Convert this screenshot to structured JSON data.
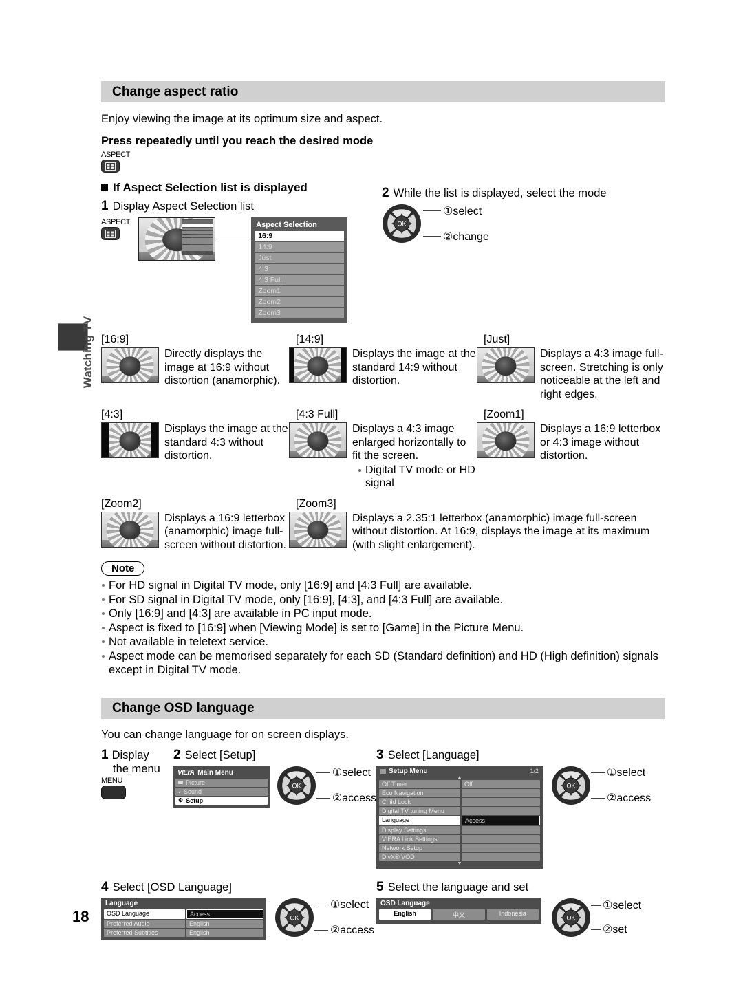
{
  "sidebar": {
    "tab_label": "Watching TV"
  },
  "page_number": "18",
  "section1": {
    "heading": "Change aspect ratio",
    "intro": "Enjoy viewing the image at its optimum size and aspect.",
    "instruction": "Press repeatedly until you reach the desired mode",
    "aspect_key_label": "ASPECT",
    "subheading": "If Aspect Selection list is displayed",
    "step1": {
      "num": "1",
      "text": "Display Aspect Selection list",
      "key_label": "ASPECT"
    },
    "step2": {
      "num": "2",
      "text": "While the list is displayed, select the mode",
      "annot1": "select",
      "annot2": "change",
      "marker1": "①",
      "marker2": "②"
    },
    "aspect_selection": {
      "title": "Aspect Selection",
      "items": [
        "16:9",
        "14:9",
        "Just",
        "4:3",
        "4:3 Full",
        "Zoom1",
        "Zoom2",
        "Zoom3"
      ],
      "selected_index": 0
    },
    "modes": [
      {
        "name": "[16:9]",
        "desc": "Directly displays the image at 16:9 without distortion (anamorphic).",
        "bars": "none"
      },
      {
        "name": "[14:9]",
        "desc": "Displays the image at the standard 14:9 without distortion.",
        "bars": "thin"
      },
      {
        "name": "[Just]",
        "desc": "Displays a 4:3 image full-screen. Stretching is only noticeable at the left and right edges.",
        "bars": "none"
      },
      {
        "name": "[4:3]",
        "desc": "Displays the image at the standard 4:3 without distortion.",
        "bars": "wide"
      },
      {
        "name": "[4:3 Full]",
        "desc": "Displays a 4:3 image enlarged horizontally to fit the screen.",
        "sub": "Digital TV mode or HD signal",
        "bars": "none"
      },
      {
        "name": "[Zoom1]",
        "desc": "Displays a 16:9 letterbox or 4:3 image without distortion.",
        "bars": "none"
      },
      {
        "name": "[Zoom2]",
        "desc": "Displays a 16:9 letterbox (anamorphic) image full-screen without distortion.",
        "bars": "none"
      },
      {
        "name": "[Zoom3]",
        "desc": "Displays a 2.35:1 letterbox (anamorphic) image full-screen without distortion. At 16:9, displays the image at its maximum (with slight enlargement).",
        "bars": "none"
      }
    ],
    "note": {
      "label": "Note",
      "items": [
        "For HD signal in Digital TV mode, only [16:9] and [4:3 Full] are available.",
        "For SD signal in Digital TV mode, only [16:9], [4:3], and [4:3 Full] are available.",
        "Only [16:9] and [4:3] are available in PC input mode.",
        "Aspect is fixed to [16:9] when [Viewing Mode] is set to [Game] in the Picture Menu.",
        "Not available in teletext service.",
        "Aspect mode can be memorised separately for each SD (Standard definition) and HD (High definition) signals except in Digital TV mode."
      ]
    }
  },
  "section2": {
    "heading": "Change OSD language",
    "intro": "You can change language for on screen displays.",
    "step1": {
      "num": "1",
      "line1": "Display",
      "line2": "the menu",
      "key_label": "MENU"
    },
    "step2": {
      "num": "2",
      "text": "Select [Setup]",
      "annot1": "select",
      "annot2": "access",
      "marker1": "①",
      "marker2": "②",
      "menu": {
        "brand": "VIErA",
        "title": "Main Menu",
        "items": [
          {
            "label": "Picture",
            "icon": "picture-icon",
            "selected": false
          },
          {
            "label": "Sound",
            "icon": "sound-icon",
            "selected": false
          },
          {
            "label": "Setup",
            "icon": "setup-icon",
            "selected": true
          }
        ]
      }
    },
    "step3": {
      "num": "3",
      "text": "Select [Language]",
      "annot1": "select",
      "annot2": "access",
      "marker1": "①",
      "marker2": "②",
      "menu": {
        "title": "Setup Menu",
        "page": "1/2",
        "rows": [
          {
            "label": "Off Timer",
            "value": "Off",
            "selected": false
          },
          {
            "label": "Eco Navigation",
            "value": "",
            "selected": false
          },
          {
            "label": "Child Lock",
            "value": "",
            "selected": false
          },
          {
            "label": "Digital TV tuning Menu",
            "value": "",
            "selected": false
          },
          {
            "label": "Language",
            "value": "Access",
            "selected": true
          },
          {
            "label": "Display Settings",
            "value": "",
            "selected": false
          },
          {
            "label": "VIERA Link Settings",
            "value": "",
            "selected": false
          },
          {
            "label": "Network Setup",
            "value": "",
            "selected": false
          },
          {
            "label": "DivX® VOD",
            "value": "",
            "selected": false
          }
        ]
      }
    },
    "step4": {
      "num": "4",
      "text": "Select [OSD Language]",
      "annot1": "select",
      "annot2": "access",
      "marker1": "①",
      "marker2": "②",
      "menu": {
        "title": "Language",
        "rows": [
          {
            "label": "OSD Language",
            "value": "Access",
            "selected": true
          },
          {
            "label": "Preferred Audio",
            "value": "English",
            "selected": false
          },
          {
            "label": "Preferred Subtitles",
            "value": "English",
            "selected": false
          }
        ]
      }
    },
    "step5": {
      "num": "5",
      "text": "Select the language and set",
      "annot1": "select",
      "annot2": "set",
      "marker1": "①",
      "marker2": "②",
      "menu": {
        "title": "OSD Language",
        "options": [
          {
            "label": "English",
            "selected": true
          },
          {
            "label": "中文",
            "selected": false
          },
          {
            "label": "Indonesia",
            "selected": false
          }
        ]
      }
    }
  },
  "colors": {
    "section_bar": "#d0d0d0",
    "osd_bg": "#4d4d4d",
    "osd_row": "#8c8c8c",
    "selected": "#ffffff"
  }
}
